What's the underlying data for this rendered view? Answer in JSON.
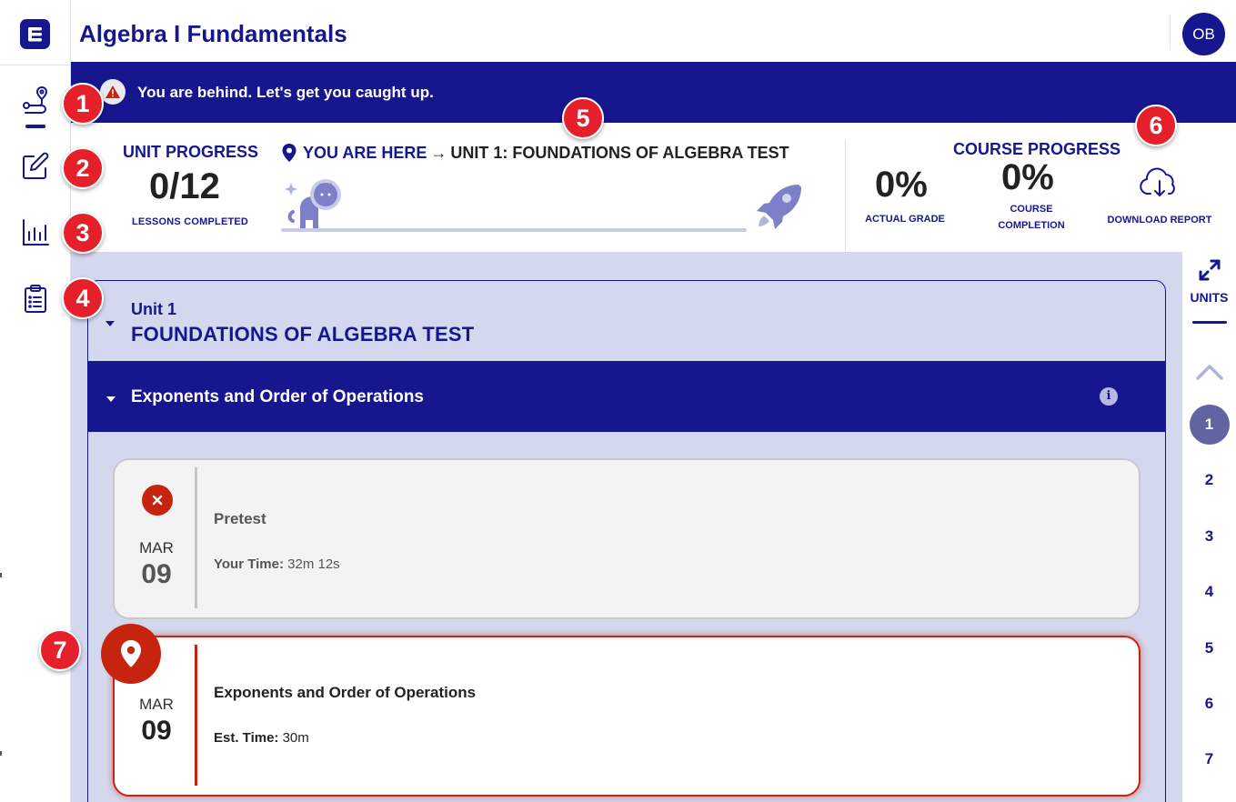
{
  "app": {
    "title": "Algebra I Fundamentals",
    "avatar_initials": "OB"
  },
  "banner": {
    "text": "You are behind. Let's get you caught up.",
    "icon": "warning-icon"
  },
  "unit_progress": {
    "label": "UNIT PROGRESS",
    "value": "0/12",
    "sub": "LESSONS COMPLETED",
    "completed_fraction": 0
  },
  "you_are_here": {
    "label": "YOU ARE HERE",
    "arrow": "→",
    "target": "UNIT 1: FOUNDATIONS OF ALGEBRA TEST"
  },
  "course_progress": {
    "label": "COURSE PROGRESS",
    "actual_grade_value": "0%",
    "actual_grade_label": "ACTUAL GRADE",
    "completion_value": "0%",
    "completion_label_1": "COURSE",
    "completion_label_2": "COMPLETION",
    "download_label": "DOWNLOAD REPORT"
  },
  "unit": {
    "number_label": "Unit 1",
    "title": "FOUNDATIONS OF ALGEBRA TEST",
    "section_title": "Exponents and Order of Operations"
  },
  "lessons": [
    {
      "status": "incomplete",
      "month": "MAR",
      "day": "09",
      "title": "Pretest",
      "time_label": "Your Time:",
      "time_value": "32m 12s"
    },
    {
      "status": "current",
      "month": "MAR",
      "day": "09",
      "title": "Exponents and Order of Operations",
      "time_label": "Est. Time:",
      "time_value": "30m"
    }
  ],
  "right_rail": {
    "units_label": "UNITS",
    "units": [
      "1",
      "2",
      "3",
      "4",
      "5",
      "6",
      "7"
    ],
    "active_unit": "1"
  },
  "callouts": [
    "1",
    "2",
    "3",
    "4",
    "5",
    "6",
    "7"
  ],
  "colors": {
    "brand": "#16178f",
    "alert": "#c7240f",
    "callout": "#e5202b",
    "content_bg": "#d4d8ee"
  }
}
